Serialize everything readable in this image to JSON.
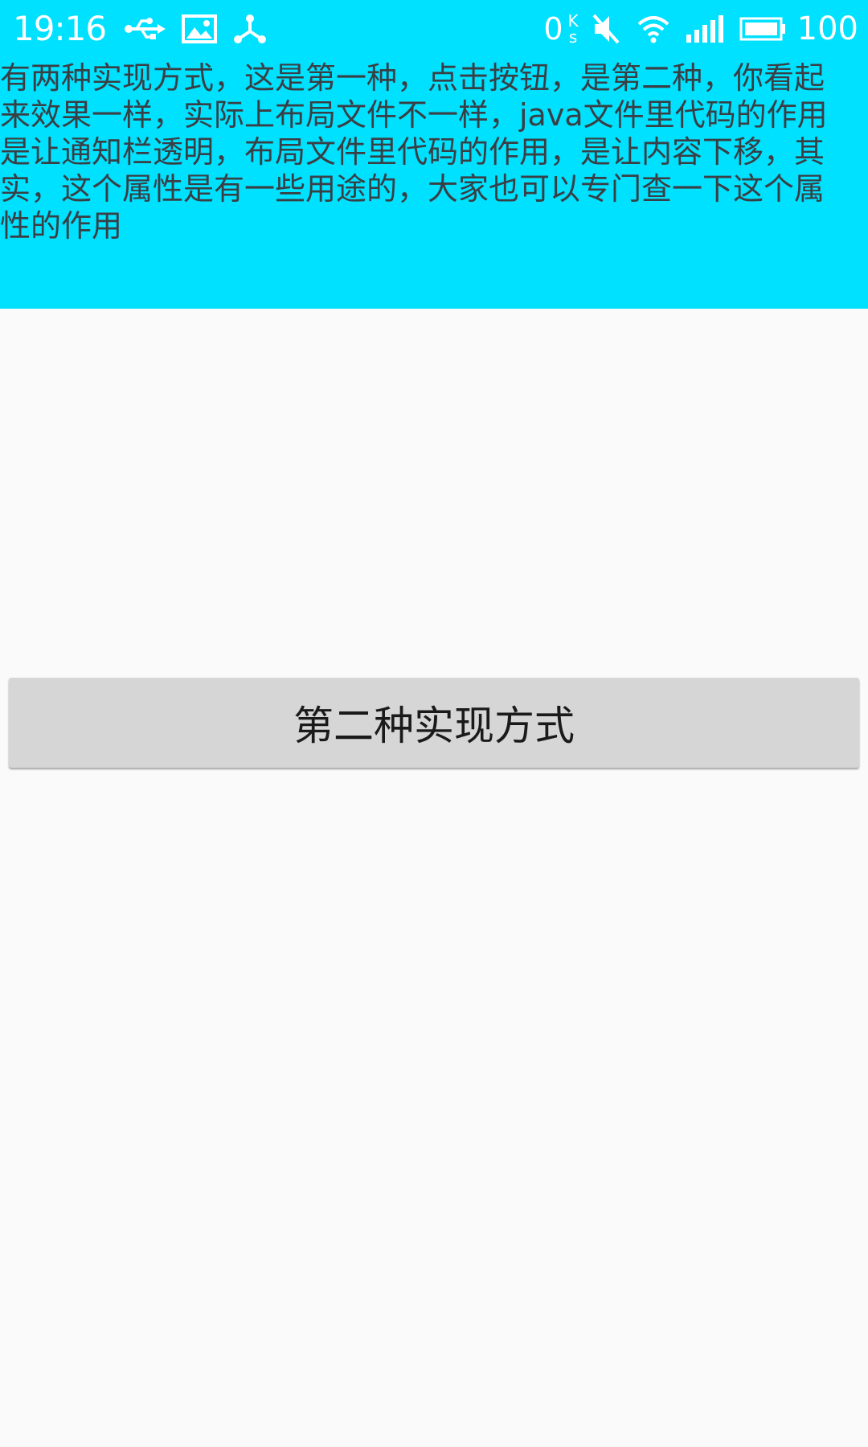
{
  "status_bar": {
    "time": "19:16",
    "icons_left": [
      "usb-icon",
      "image-icon",
      "share-icon"
    ],
    "net_speed_value": "0",
    "net_speed_unit_top": "K",
    "net_speed_unit_bottom": "s",
    "icons_right": [
      "mute-icon",
      "wifi-icon",
      "signal-icon",
      "battery-icon"
    ],
    "battery_level": "100"
  },
  "header": {
    "background_color": "#00e0ff",
    "text": "有两种实现方式，这是第一种，点击按钮，是第二种，你看起来效果一样，实际上布局文件不一样，java文件里代码的作用是让通知栏透明，布局文件里代码的作用，是让内容下移，其实，这个属性是有一些用途的，大家也可以专门查一下这个属性的作用"
  },
  "main": {
    "button_label": "第二种实现方式",
    "button_color": "#d6d6d6",
    "background_color": "#fafafa"
  }
}
